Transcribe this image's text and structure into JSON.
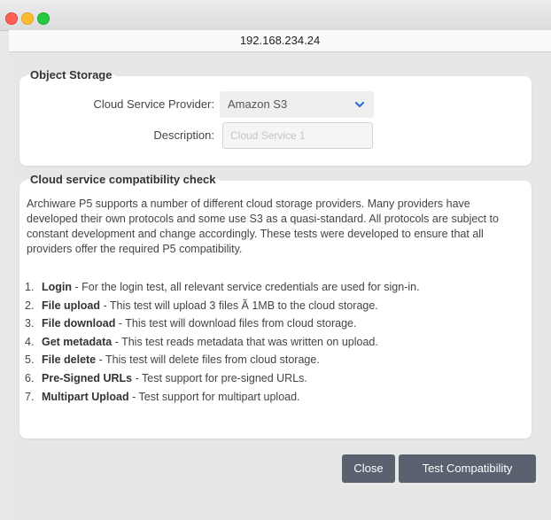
{
  "window": {
    "url": "192.168.234.24"
  },
  "object_storage": {
    "title": "Object Storage",
    "provider_label": "Cloud Service Provider:",
    "provider_value": "Amazon S3",
    "description_label": "Description:",
    "description_placeholder": "Cloud Service 1"
  },
  "compat": {
    "title": "Cloud service compatibility check",
    "intro": "Archiware P5 supports a number of different cloud storage providers. Many providers have developed their own protocols and some use S3 as a quasi-standard. All protocols are subject to constant development and change accordingly. These tests were developed to ensure that all providers offer the required P5 compatibility.",
    "tests": [
      {
        "num": "1.",
        "name": "Login",
        "desc": " - For the login test, all relevant service credentials are used for sign-in."
      },
      {
        "num": "2.",
        "name": "File upload",
        "desc": " - This test will upload 3 files Ã  1MB to the cloud storage."
      },
      {
        "num": "3.",
        "name": "File download",
        "desc": " - This test will download files from cloud storage."
      },
      {
        "num": "4.",
        "name": "Get metadata",
        "desc": " - This test reads metadata that was written on upload."
      },
      {
        "num": "5.",
        "name": "File delete",
        "desc": " - This test will delete files from cloud storage."
      },
      {
        "num": "6.",
        "name": "Pre-Signed URLs",
        "desc": " - Test support for pre-signed URLs."
      },
      {
        "num": "7.",
        "name": "Multipart Upload",
        "desc": " - Test support for multipart upload."
      }
    ]
  },
  "buttons": {
    "close": "Close",
    "test": "Test Compatibility"
  },
  "colors": {
    "button_bg": "#5a6270",
    "chevron": "#2f6fd6"
  },
  "icons": {
    "select_arrow": "chevron-down-icon"
  }
}
